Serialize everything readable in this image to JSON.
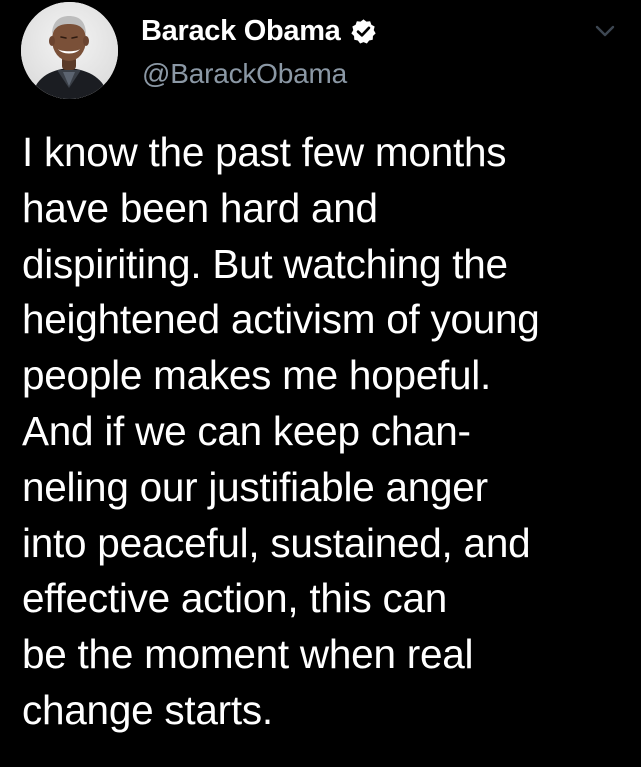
{
  "author": {
    "display_name": "Barack Obama",
    "handle": "@BarackObama",
    "verified": true
  },
  "icons": {
    "verified": "verified-badge-icon",
    "menu": "chevron-down-icon"
  },
  "colors": {
    "background": "#000000",
    "text": "#ffffff",
    "handle": "#8b98a5",
    "caret": "#3d4752"
  },
  "tweet": {
    "lines": [
      "I know the past few months",
      "have been hard and",
      "dispiriting. But watching the",
      "heightened activism of young",
      "people makes me hopeful.",
      "And if we can keep chan-",
      "neling our justifiable anger",
      "into peaceful, sustained, and",
      "effective action, this can",
      "be the moment when real",
      "change starts."
    ]
  }
}
